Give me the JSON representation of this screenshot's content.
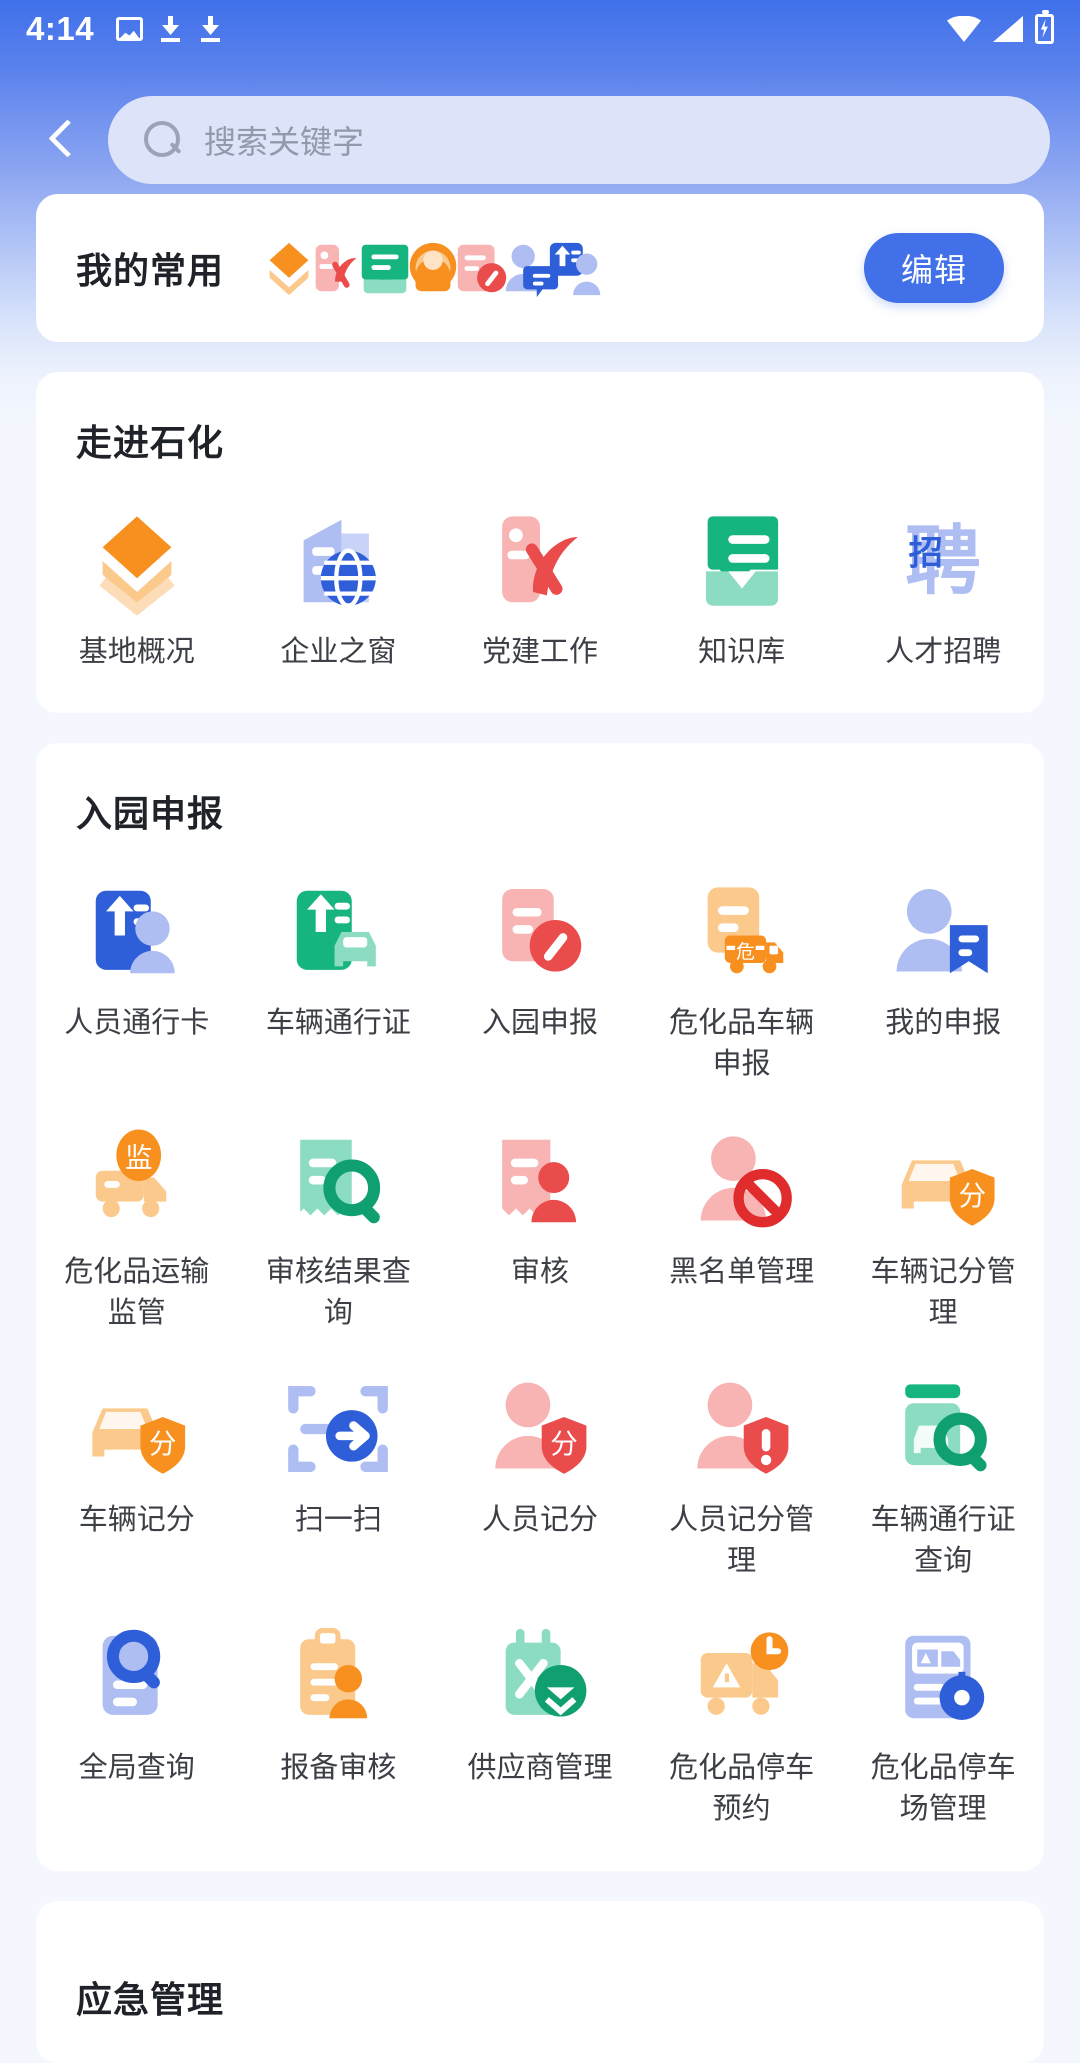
{
  "status_bar": {
    "time": "4:14",
    "left_icons": [
      "image-icon",
      "download-icon",
      "download-icon"
    ],
    "right_icons": [
      "wifi-icon",
      "signal-icon",
      "battery-charging-icon"
    ]
  },
  "header": {
    "back_icon": "chevron-left-icon",
    "search": {
      "icon": "search-icon",
      "placeholder": "搜索关键字",
      "value": ""
    }
  },
  "favorites": {
    "title": "我的常用",
    "edit_label": "编辑",
    "icons": [
      "layers-icon",
      "party-emblem-icon",
      "message-icon",
      "service-person-icon",
      "edit-document-icon",
      "people-chat-icon",
      "person-card-icon"
    ]
  },
  "sections": [
    {
      "title": "走进石化",
      "items": [
        {
          "label": "基地概况",
          "icon": "layers-icon"
        },
        {
          "label": "企业之窗",
          "icon": "building-globe-icon"
        },
        {
          "label": "党建工作",
          "icon": "party-emblem-icon"
        },
        {
          "label": "知识库",
          "icon": "knowledge-message-icon"
        },
        {
          "label": "人才招聘",
          "icon": "recruit-icon"
        }
      ]
    },
    {
      "title": "入园申报",
      "items": [
        {
          "label": "人员通行卡",
          "icon": "person-pass-card-icon"
        },
        {
          "label": "车辆通行证",
          "icon": "vehicle-pass-icon"
        },
        {
          "label": "入园申报",
          "icon": "declare-edit-icon"
        },
        {
          "label": "危化品车辆申报",
          "icon": "hazmat-truck-declare-icon"
        },
        {
          "label": "我的申报",
          "icon": "my-declaration-icon"
        },
        {
          "label": "危化品运输监管",
          "icon": "hazmat-transport-supervise-icon"
        },
        {
          "label": "审核结果查询",
          "icon": "audit-result-search-icon"
        },
        {
          "label": "审核",
          "icon": "audit-icon"
        },
        {
          "label": "黑名单管理",
          "icon": "blacklist-icon"
        },
        {
          "label": "车辆记分管理",
          "icon": "vehicle-score-manage-icon"
        },
        {
          "label": "车辆记分",
          "icon": "vehicle-score-icon"
        },
        {
          "label": "扫一扫",
          "icon": "scan-icon"
        },
        {
          "label": "人员记分",
          "icon": "person-score-icon"
        },
        {
          "label": "人员记分管理",
          "icon": "person-score-manage-icon"
        },
        {
          "label": "车辆通行证查询",
          "icon": "vehicle-pass-search-icon"
        },
        {
          "label": "全局查询",
          "icon": "global-search-icon"
        },
        {
          "label": "报备审核",
          "icon": "report-audit-icon"
        },
        {
          "label": "供应商管理",
          "icon": "supplier-manage-icon"
        },
        {
          "label": "危化品停车预约",
          "icon": "hazmat-parking-book-icon"
        },
        {
          "label": "危化品停车场管理",
          "icon": "hazmat-parking-manage-icon"
        }
      ]
    },
    {
      "title": "应急管理",
      "items": []
    }
  ],
  "colors": {
    "header_gradient_top": "#3f70ea",
    "page_background": "#f4f7fd",
    "card_background": "#ffffff",
    "accent_blue": "#4170e8",
    "search_field": "#dde4fa",
    "title_text": "#1f2329",
    "label_text": "#3c3f46",
    "placeholder_text": "#9299ab",
    "orange": "#f7901e",
    "orange_light": "#fbc98c",
    "red": "#ea4b4b",
    "red_light": "#f8b3b3",
    "green": "#16b47f",
    "green_light": "#8bdcc2",
    "blue_light": "#aebdf2",
    "blue_deep": "#2f5fd8"
  }
}
